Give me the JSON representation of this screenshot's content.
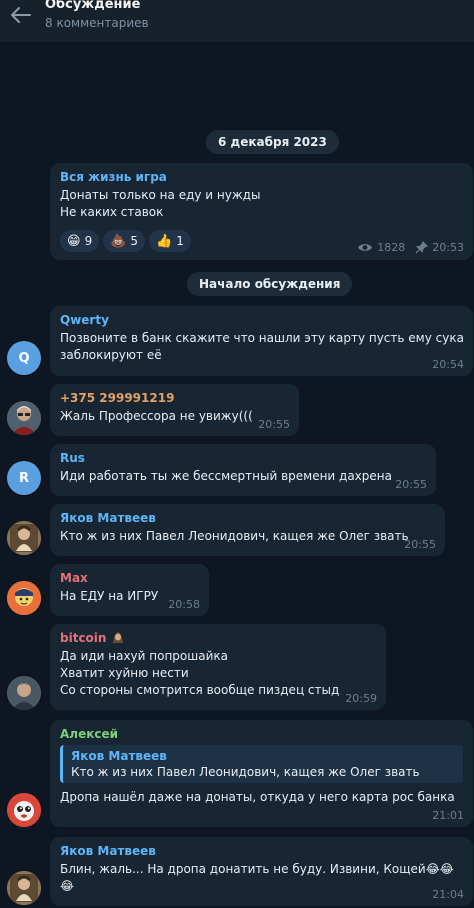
{
  "header": {
    "title": "Обсуждение",
    "subtitle": "8 комментариев"
  },
  "date_pill": "6 декабря 2023",
  "post": {
    "channel_name": "Вся жизнь игра",
    "lines": [
      "Донаты только на еду и нужды",
      "Не каких ставок"
    ],
    "reactions": [
      {
        "emoji": "😁",
        "count": "9"
      },
      {
        "emoji": "💩",
        "count": "5"
      },
      {
        "emoji": "👍",
        "count": "1"
      }
    ],
    "views": "1828",
    "time": "20:53"
  },
  "discussion_pill": "Начало обсуждения",
  "colors": {
    "background": "#0e1621",
    "bubble": "#182533",
    "header": "#17212b",
    "name_blue": "#5eb5f7",
    "name_orange": "#e5a064",
    "name_red": "#e4717a",
    "name_green": "#7fd07a"
  },
  "messages": [
    {
      "author": "Qwerty",
      "avatar_letter": "Q",
      "lines": [
        "Позвоните в банк скажите что нашли эту карту пусть ему сука",
        "заблокируют её"
      ],
      "time": "20:54"
    },
    {
      "author": "+375 299991219",
      "lines": [
        "Жаль Профессора не увижу((("
      ],
      "time": "20:55"
    },
    {
      "author": "Rus",
      "avatar_letter": "R",
      "lines": [
        "Иди работать ты же бессмертный времени дахрена"
      ],
      "time": "20:55"
    },
    {
      "author": "Яков Матвеев",
      "lines": [
        "Кто ж из них Павел Леонидович, кащея же Олег звать"
      ],
      "time": "20:55"
    },
    {
      "author": "Max",
      "lines": [
        "На ЕДУ на ИГРУ"
      ],
      "time": "20:58"
    },
    {
      "author": "bitcoin",
      "lines": [
        "Да иди нахуй попрошайка",
        "Хватит хуйню нести",
        "Со стороны смотрится вообще пиздец стыд"
      ],
      "time": "20:59"
    },
    {
      "author": "Алексей",
      "reply_author": "Яков Матвеев",
      "reply_text": "Кто ж из них Павел Леонидович, кащея же Олег звать",
      "lines": [
        "Дропа нашёл даже на донаты, откуда у него карта рос банка"
      ],
      "time": "21:01"
    },
    {
      "author": "Яков Матвеев",
      "lines": [
        "Блин, жаль... На дропа донатить не буду. Извини, Кощей😂😂",
        "😂"
      ],
      "time": "21:04"
    }
  ]
}
